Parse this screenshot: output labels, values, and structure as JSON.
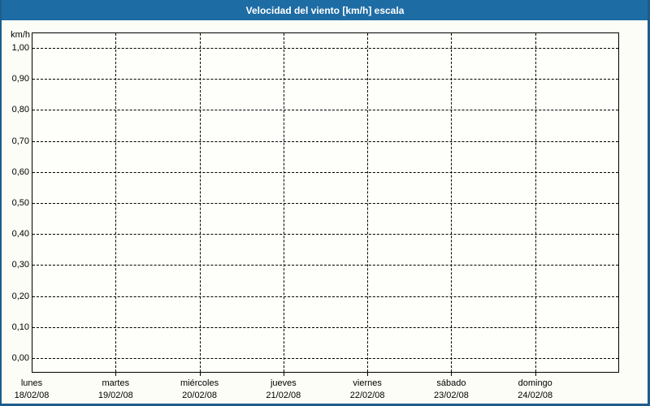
{
  "window": {
    "title": "Velocidad del viento [km/h] escala"
  },
  "chart": {
    "unit_label": "km/h",
    "y_ticks": [
      "1,00",
      "0,90",
      "0,80",
      "0,70",
      "0,60",
      "0,50",
      "0,40",
      "0,30",
      "0,20",
      "0,10",
      "0,00"
    ],
    "x_ticks": [
      {
        "day": "lunes",
        "date": "18/02/08"
      },
      {
        "day": "martes",
        "date": "19/02/08"
      },
      {
        "day": "miércoles",
        "date": "20/02/08"
      },
      {
        "day": "jueves",
        "date": "21/02/08"
      },
      {
        "day": "viernes",
        "date": "22/02/08"
      },
      {
        "day": "sábado",
        "date": "23/02/08"
      },
      {
        "day": "domingo",
        "date": "24/02/08"
      }
    ]
  },
  "colors": {
    "title_bar_bg": "#1E6CA4",
    "title_text": "#FFFFFF",
    "frame_border": "#1E5C8B",
    "page_bg": "#FBFDF6",
    "plot_bg": "#FEFFFB",
    "grid": "#000000"
  },
  "chart_data": {
    "type": "line",
    "title": "Velocidad del viento [km/h] escala",
    "xlabel": "",
    "ylabel": "km/h",
    "ylim": [
      0.0,
      1.0
    ],
    "y_tick_step": 0.1,
    "y_tick_labels": [
      "1,00",
      "0,90",
      "0,80",
      "0,70",
      "0,60",
      "0,50",
      "0,40",
      "0,30",
      "0,20",
      "0,10",
      "0,00"
    ],
    "x_categories": [
      "lunes 18/02/08",
      "martes 19/02/08",
      "miércoles 20/02/08",
      "jueves 21/02/08",
      "viernes 22/02/08",
      "sábado 23/02/08",
      "domingo 24/02/08"
    ],
    "series": [],
    "grid": "dashed",
    "legend": "none"
  }
}
